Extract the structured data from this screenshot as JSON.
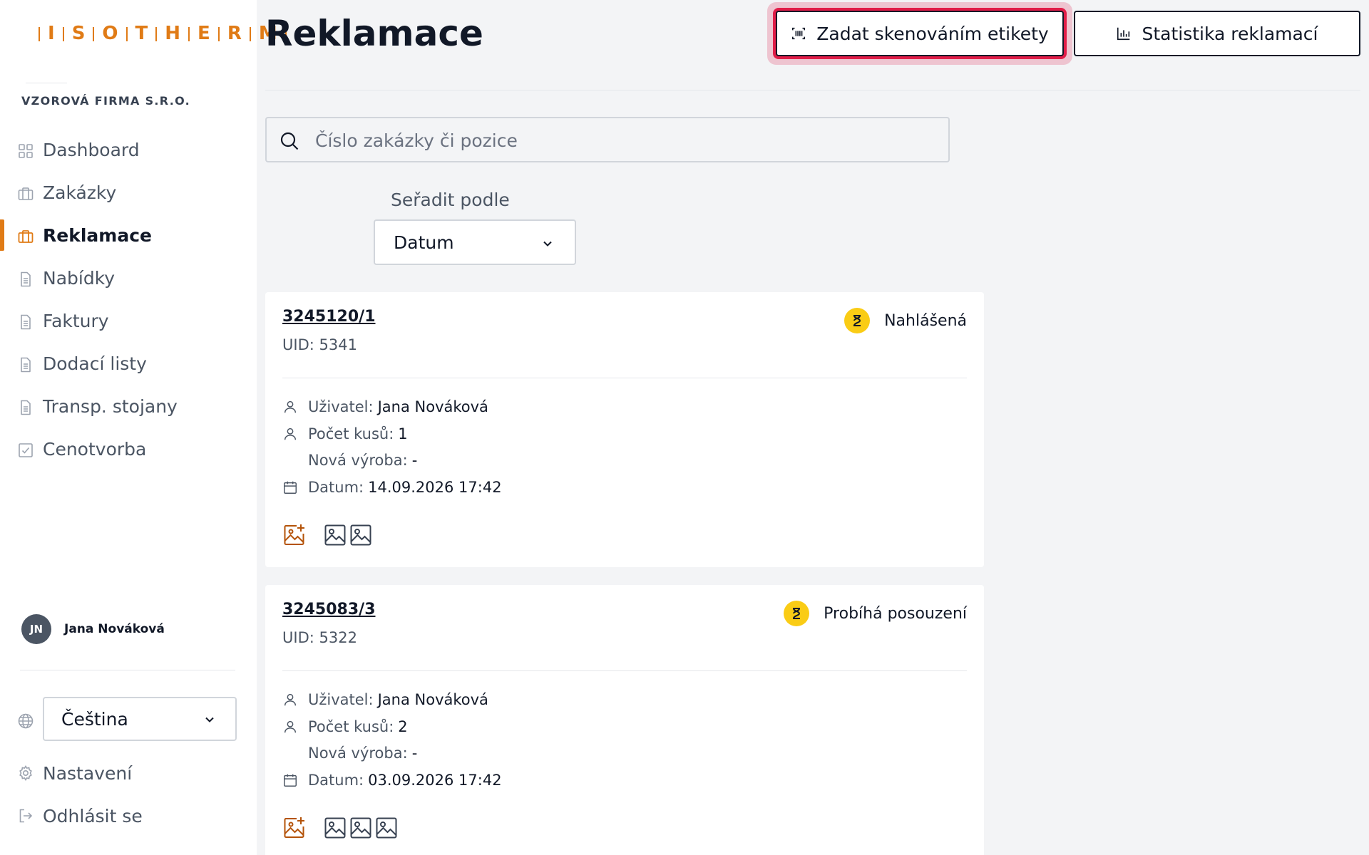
{
  "brand": {
    "logo_letters": [
      "I",
      "S",
      "O",
      "T",
      "H",
      "E",
      "R",
      "M"
    ],
    "accent_color": "#e07b16",
    "company": "VZOROVÁ FIRMA S.R.O."
  },
  "sidebar": {
    "items": [
      {
        "label": "Dashboard",
        "icon": "grid-icon"
      },
      {
        "label": "Zakázky",
        "icon": "briefcase-icon"
      },
      {
        "label": "Reklamace",
        "icon": "briefcase-icon",
        "active": true
      },
      {
        "label": "Nabídky",
        "icon": "document-icon"
      },
      {
        "label": "Faktury",
        "icon": "document-icon"
      },
      {
        "label": "Dodací listy",
        "icon": "document-icon"
      },
      {
        "label": "Transp. stojany",
        "icon": "document-icon"
      },
      {
        "label": "Cenotvorba",
        "icon": "checkbox-icon"
      }
    ],
    "user": {
      "initials": "JN",
      "name": "Jana Nováková"
    },
    "language": "Čeština",
    "settings_label": "Nastavení",
    "logout_label": "Odhlásit se"
  },
  "header": {
    "title": "Reklamace",
    "scan_button": "Zadat skenováním etikety",
    "stats_button": "Statistika reklamací"
  },
  "search": {
    "placeholder": "Číslo zakázky či pozice",
    "value": ""
  },
  "sort": {
    "label": "Seřadit podle",
    "selected": "Datum"
  },
  "labels": {
    "user": "Uživatel:",
    "pieces": "Počet kusů:",
    "new_production": "Nová výroba:",
    "date": "Datum:"
  },
  "claims": [
    {
      "id": "3245120/1",
      "uid": "UID: 5341",
      "status": "Nahlášená",
      "status_color": "#facc15",
      "user": "Jana Nováková",
      "pieces": "1",
      "new_production": "-",
      "date": "14.09.2026 17:42",
      "photo_count": 2
    },
    {
      "id": "3245083/3",
      "uid": "UID: 5322",
      "status": "Probíhá posouzení",
      "status_color": "#facc15",
      "user": "Jana Nováková",
      "pieces": "2",
      "new_production": "-",
      "date": "03.09.2026 17:42",
      "photo_count": 3
    }
  ]
}
